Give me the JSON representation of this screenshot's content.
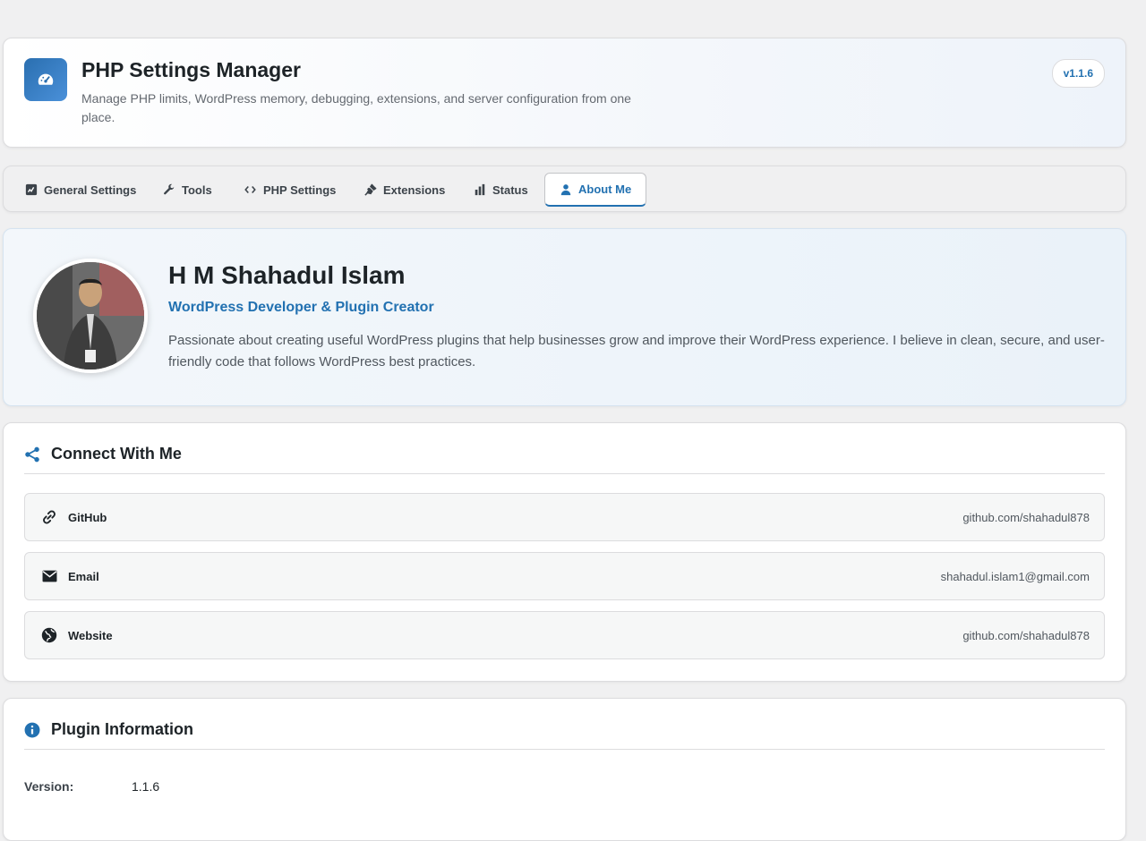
{
  "header": {
    "title": "PHP Settings Manager",
    "description": "Manage PHP limits, WordPress memory, debugging, extensions, and server configuration from one place.",
    "version_badge": "v1.1.6",
    "logo_icon": "dashboard-gauge-icon",
    "accent_color": "#2271b1"
  },
  "tabs": [
    {
      "label": "General Settings",
      "icon": "dashboard-icon",
      "active": false
    },
    {
      "label": "Tools",
      "icon": "wrench-icon",
      "active": false
    },
    {
      "label": "PHP Settings",
      "icon": "code-icon",
      "active": false
    },
    {
      "label": "Extensions",
      "icon": "plugin-icon",
      "active": false
    },
    {
      "label": "Status",
      "icon": "bar-chart-icon",
      "active": false
    },
    {
      "label": "About Me",
      "icon": "user-icon",
      "active": true
    }
  ],
  "profile": {
    "name": "H M Shahadul Islam",
    "role": "WordPress Developer & Plugin Creator",
    "bio": "Passionate about creating useful WordPress plugins that help businesses grow and improve their WordPress experience. I believe in clean, secure, and user-friendly code that follows WordPress best practices."
  },
  "connect": {
    "title": "Connect With Me",
    "links": [
      {
        "label": "GitHub",
        "value": "github.com/shahadul878",
        "icon": "link-icon"
      },
      {
        "label": "Email",
        "value": "shahadul.islam1@gmail.com",
        "icon": "email-icon"
      },
      {
        "label": "Website",
        "value": "github.com/shahadul878",
        "icon": "globe-icon"
      }
    ]
  },
  "plugin_info": {
    "title": "Plugin Information",
    "version_label": "Version:",
    "version_value": "1.1.6"
  }
}
